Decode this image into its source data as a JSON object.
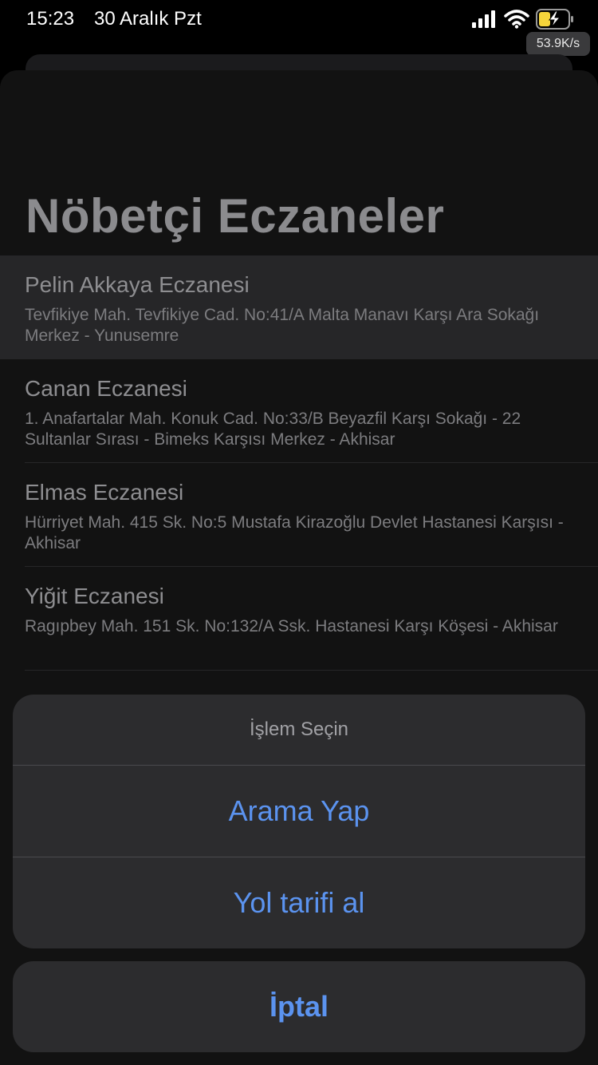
{
  "status_bar": {
    "time": "15:23",
    "date": "30 Aralık Pzt",
    "network_speed": "53.9K/s",
    "icons": [
      "signal-icon",
      "wifi-icon",
      "battery-charging-icon"
    ]
  },
  "page": {
    "title": "Nöbetçi Eczaneler"
  },
  "pharmacies": [
    {
      "name": "Pelin Akkaya Eczanesi",
      "address": "Tevfikiye Mah. Tevfikiye Cad. No:41/A Malta Manavı Karşı Ara Sokağı Merkez - Yunusemre"
    },
    {
      "name": "Canan Eczanesi",
      "address": "1. Anafartalar Mah. Konuk Cad. No:33/B Beyazfil Karşı Sokağı - 22 Sultanlar Sırası - Bimeks Karşısı Merkez - Akhisar"
    },
    {
      "name": "Elmas Eczanesi",
      "address": "Hürriyet Mah. 415 Sk. No:5 Mustafa Kirazoğlu Devlet Hastanesi Karşısı - Akhisar"
    },
    {
      "name": "Yiğit Eczanesi",
      "address": "Ragıpbey Mah. 151 Sk. No:132/A Ssk. Hastanesi Karşı Köşesi - Akhisar"
    }
  ],
  "action_sheet": {
    "title": "İşlem Seçin",
    "call_label": "Arama Yap",
    "directions_label": "Yol tarifi al",
    "cancel_label": "İptal"
  },
  "colors": {
    "accent": "#5b93ef",
    "sheet_background": "#2c2c2e",
    "list_background": "#121212"
  }
}
